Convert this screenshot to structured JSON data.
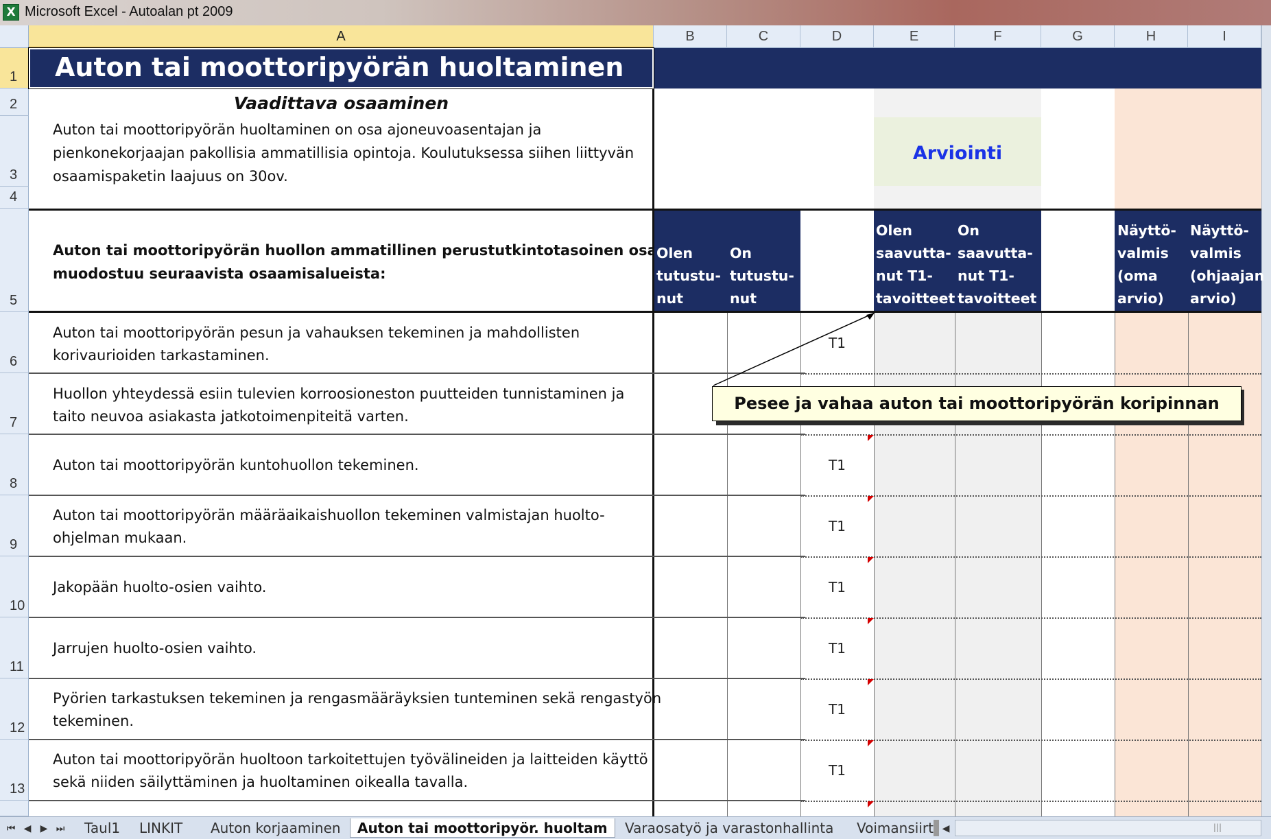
{
  "window": {
    "title": "Microsoft Excel - Autoalan pt 2009",
    "app_icon": "X"
  },
  "columns": [
    "A",
    "B",
    "C",
    "D",
    "E",
    "F",
    "G",
    "H",
    "I"
  ],
  "rows": [
    "1",
    "2",
    "3",
    "4",
    "5",
    "6",
    "7",
    "8",
    "9",
    "10",
    "11",
    "12",
    "13"
  ],
  "sheet": {
    "title": "Auton tai moottoripyörän huoltaminen",
    "section_heading": "Vaadittava osaaminen",
    "intro_line1": "Auton tai moottoripyörän huoltaminen on osa ajoneuvoasentajan ja",
    "intro_line2": "pienkonekorjaajan pakollisia ammatillisia opintoja. Koulutuksessa siihen liittyvän",
    "intro_line3": "osaamispaketin laajuus on 30ov.",
    "arviointi": "Arviointi",
    "areas_heading_line1": "Auton tai moottoripyörän huollon ammatillinen perustutkintotasoinen osaaminen",
    "areas_heading_line2": "muodostuu seuraavista osaamisalueista:",
    "col_b_header": [
      "Olen",
      "tutustu-",
      "nut"
    ],
    "col_c_header": [
      "On",
      "tutustu-",
      "nut"
    ],
    "col_e_header": [
      "Olen",
      "saavutta-",
      "nut T1-",
      "tavoitteet"
    ],
    "col_f_header": [
      "On",
      "saavutta-",
      "nut T1-",
      "tavoitteet"
    ],
    "col_h_header": [
      "Näyttö-",
      "valmis",
      "(oma",
      "arvio)"
    ],
    "col_i_header": [
      "Näyttö-",
      "valmis",
      "(ohjaajan",
      " arvio)"
    ],
    "items": [
      {
        "line1": "Auton tai moottoripyörän pesun ja vahauksen tekeminen ja mahdollisten",
        "line2": "korivaurioiden tarkastaminen.",
        "level": "T1"
      },
      {
        "line1": "Huollon yhteydessä esiin tulevien korroosioneston puutteiden tunnistaminen ja",
        "line2": "taito neuvoa asiakasta jatkotoimenpiteitä varten.",
        "level": ""
      },
      {
        "line1": "Auton tai moottoripyörän kuntohuollon tekeminen.",
        "line2": "",
        "level": "T1"
      },
      {
        "line1": "Auton tai moottoripyörän määräaikaishuollon tekeminen valmistajan huolto-",
        "line2": "ohjelman mukaan.",
        "level": "T1"
      },
      {
        "line1": "Jakopään huolto-osien vaihto.",
        "line2": "",
        "level": "T1"
      },
      {
        "line1": "Jarrujen huolto-osien vaihto.",
        "line2": "",
        "level": "T1"
      },
      {
        "line1": "Pyörien tarkastuksen tekeminen ja rengasmääräyksien tunteminen sekä rengastyön",
        "line2": "tekeminen.",
        "level": "T1"
      },
      {
        "line1": "Auton tai moottoripyörän huoltoon tarkoitettujen työvälineiden ja laitteiden käyttö",
        "line2": "sekä niiden säilyttäminen ja huoltaminen oikealla tavalla.",
        "level": "T1"
      }
    ],
    "comment": "Pesee ja vahaa auton tai moottoripyörän koripinnan"
  },
  "tabs": [
    "Taul1",
    "LINKIT",
    "Auton korjaaminen",
    "Auton tai moottoripyör. huoltam",
    "Varaosatyö ja varastonhallinta",
    "Voimansiirt"
  ],
  "active_tab_index": 3,
  "colors": {
    "navy": "#1c2d63",
    "arviointi_blue": "#1a33e6",
    "peach": "#fbe5d6",
    "light_gray": "#f0f0f0",
    "light_green": "#ebf1de"
  }
}
